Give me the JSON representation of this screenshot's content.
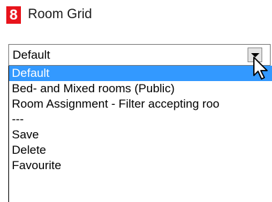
{
  "header": {
    "step_number": "8",
    "title": "Room Grid"
  },
  "select": {
    "value": "Default",
    "options": [
      "Default",
      "Bed- and Mixed rooms (Public)",
      "Room Assignment - Filter accepting roo",
      "---",
      "Save",
      "Delete",
      "Favourite"
    ]
  },
  "colors": {
    "badge": "#e8141c",
    "selection": "#3399ff"
  },
  "icons": {
    "dropdown_arrow": "chevron-down-icon",
    "cursor": "mouse-pointer-icon"
  }
}
